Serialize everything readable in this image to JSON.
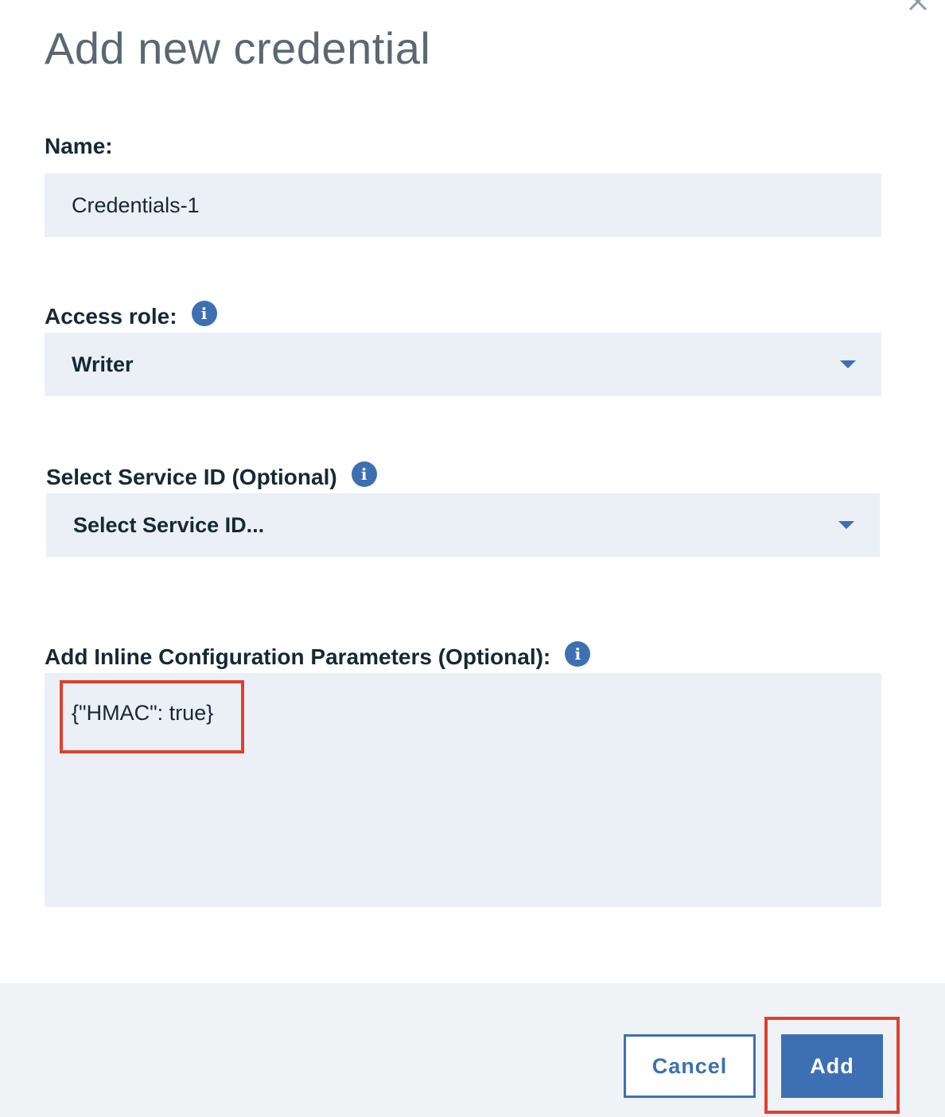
{
  "dialog": {
    "title": "Add new credential",
    "close_icon": "close-icon"
  },
  "name_field": {
    "label": "Name:",
    "value": "Credentials-1"
  },
  "access_role": {
    "label": "Access role:",
    "info_icon": "info-icon",
    "selected": "Writer"
  },
  "service_id": {
    "label": "Select Service ID (Optional)",
    "info_icon": "info-icon",
    "selected": "Select Service ID..."
  },
  "inline_params": {
    "label": "Add Inline Configuration Parameters (Optional):",
    "info_icon": "info-icon",
    "value": "{\"HMAC\": true}"
  },
  "footer": {
    "cancel_label": "Cancel",
    "add_label": "Add"
  },
  "colors": {
    "primary": "#3d70b2",
    "field_bg": "#ebf0f7",
    "footer_bg": "#f0f3f6",
    "highlight": "#e0402e",
    "title_text": "#5a6872",
    "body_text": "#152935"
  }
}
